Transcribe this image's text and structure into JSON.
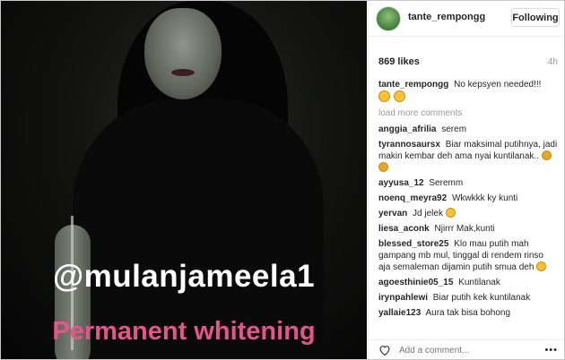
{
  "post": {
    "overlay_tag": "@mulanjameela1",
    "overlay_caption": "Permanent whitening"
  },
  "header": {
    "username": "tante_rempongg",
    "follow_label": "Following"
  },
  "meta": {
    "likes": "869 likes",
    "time": "4h"
  },
  "caption": {
    "user": "tante_rempongg",
    "text": "No kepsyen needed!!!"
  },
  "load_more": "load more comments",
  "comments": [
    {
      "user": "anggia_afrilia",
      "text": "serem"
    },
    {
      "user": "tyrannosaursx",
      "text": "Biar maksimal putihnya, jadi makin kembar deh ama nyai kuntilanak.."
    },
    {
      "user": "ayyusa_12",
      "text": "Seremm"
    },
    {
      "user": "noenq_meyra92",
      "text": "Wkwkkk ky kunti"
    },
    {
      "user": "yervan",
      "text": "Jd jelek"
    },
    {
      "user": "liesa_aconk",
      "text": "Njirrr Mak,kunti"
    },
    {
      "user": "blessed_store25",
      "text": "Klo mau putih mah gampang mb mul, tinggal di rendem rinso aja semaleman dijamin putih smua deh"
    },
    {
      "user": "agoesthinie05_15",
      "text": "Kuntilanak"
    },
    {
      "user": "irynpahlewi",
      "text": "Biar putih kek kuntilanak"
    },
    {
      "user": "yallaie123",
      "text": "Aura tak bisa bohong"
    }
  ],
  "footer": {
    "comment_placeholder": "Add a comment...",
    "more_label": "•••"
  },
  "icons": {
    "heart": "heart-icon",
    "more": "more-options-icon",
    "emoji": "grinning-emoji-icon"
  },
  "colors": {
    "overlay_tag": "#ffffff",
    "overlay_caption": "#e6558a",
    "secondary_text": "#999999"
  }
}
